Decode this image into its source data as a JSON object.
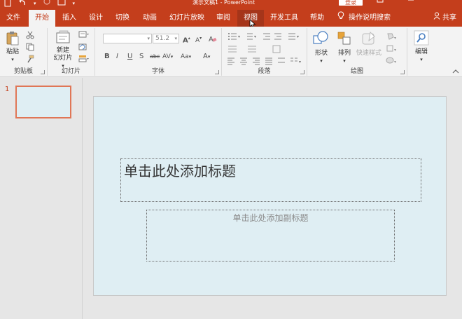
{
  "titlebar": {
    "document_title": "演示文稿1 - PowerPoint",
    "login_label": "登录",
    "qat_icons": [
      "save-icon",
      "undo-icon",
      "redo-icon",
      "start-from-beginning-icon",
      "customize-qat-icon"
    ],
    "window_buttons": [
      "ribbon-display-options-icon",
      "minimize-icon"
    ]
  },
  "tabs": [
    {
      "label": "文件"
    },
    {
      "label": "开始"
    },
    {
      "label": "插入"
    },
    {
      "label": "设计"
    },
    {
      "label": "切换"
    },
    {
      "label": "动画"
    },
    {
      "label": "幻灯片放映"
    },
    {
      "label": "审阅"
    },
    {
      "label": "视图"
    },
    {
      "label": "开发工具"
    },
    {
      "label": "帮助"
    }
  ],
  "active_tab": "开始",
  "hovered_tab": "视图",
  "tell_me": {
    "icon": "lightbulb-icon",
    "label": "操作说明搜索"
  },
  "share": {
    "icon": "person-icon",
    "label": "共享"
  },
  "ribbon": {
    "clipboard": {
      "group_label": "剪贴板",
      "paste_label": "粘贴"
    },
    "slides": {
      "group_label": "幻灯片",
      "new_slide_label_1": "新建",
      "new_slide_label_2": "幻灯片"
    },
    "font": {
      "group_label": "字体",
      "font_name": "",
      "font_size": "51.2",
      "tools": [
        "B",
        "I",
        "U",
        "S",
        "abc",
        "AV",
        "Aa",
        "A"
      ]
    },
    "paragraph": {
      "group_label": "段落"
    },
    "drawing": {
      "group_label": "绘图",
      "shapes_label": "形状",
      "arrange_label": "排列",
      "quick_styles_label": "快速样式"
    },
    "editing": {
      "group_label": "",
      "edit_label": "编辑"
    }
  },
  "thumbnails": [
    {
      "number": "1"
    }
  ],
  "slide": {
    "title_placeholder": "单击此处添加标题",
    "subtitle_placeholder": "单击此处添加副标题"
  },
  "colors": {
    "accent": "#c43e1c",
    "slide_bg": "#dfeef3",
    "thumb_border": "#e07656"
  }
}
